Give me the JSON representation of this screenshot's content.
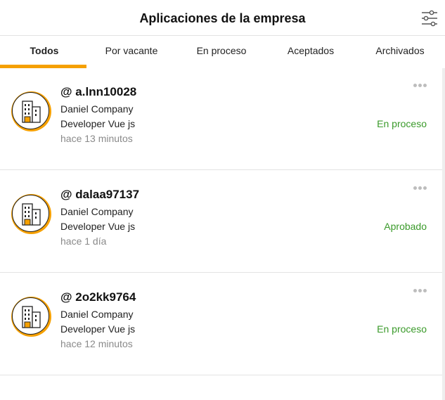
{
  "header": {
    "title": "Aplicaciones de la empresa",
    "filter_icon": "sliders-icon"
  },
  "tabs": [
    {
      "label": "Todos",
      "active": true
    },
    {
      "label": "Por vacante",
      "active": false
    },
    {
      "label": "En proceso",
      "active": false
    },
    {
      "label": "Aceptados",
      "active": false
    },
    {
      "label": "Archivados",
      "active": false
    }
  ],
  "colors": {
    "accent": "#f5a000",
    "status_green": "#3a9a2a",
    "muted": "#8a8a8a"
  },
  "applications": [
    {
      "user": "@ a.lnn10028",
      "company": "Daniel Company",
      "position": "Developer Vue js",
      "time": "hace 13 minutos",
      "status": "En proceso"
    },
    {
      "user": "@ dalaa97137",
      "company": "Daniel Company",
      "position": "Developer Vue js",
      "time": "hace 1 día",
      "status": "Aprobado"
    },
    {
      "user": "@ 2o2kk9764",
      "company": "Daniel Company",
      "position": "Developer Vue js",
      "time": "hace 12 minutos",
      "status": "En proceso"
    }
  ]
}
